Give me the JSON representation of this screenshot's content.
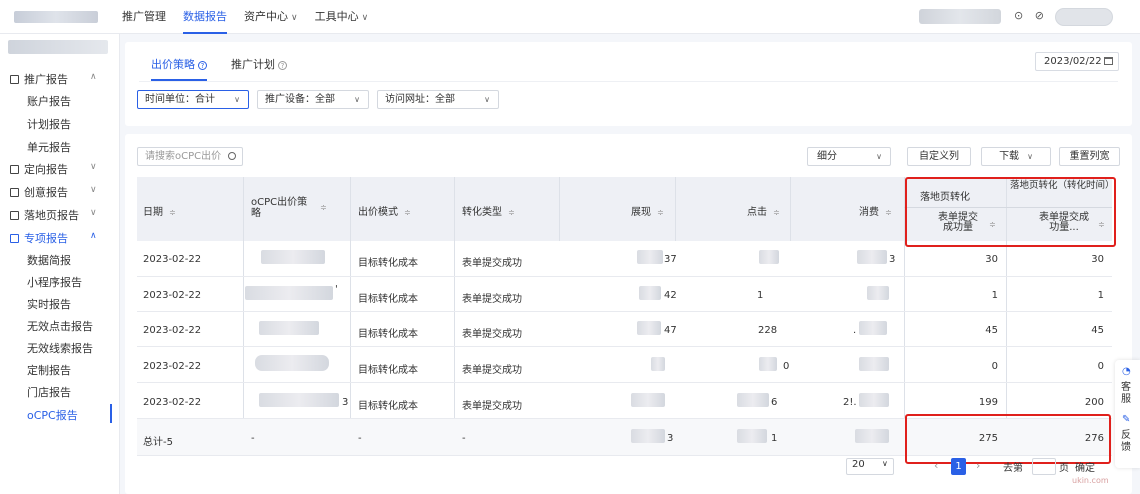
{
  "topbar": {
    "nav": [
      {
        "label": "推广管理",
        "active": false,
        "dropdown": false
      },
      {
        "label": "数据报告",
        "active": true,
        "dropdown": false
      },
      {
        "label": "资产中心",
        "active": false,
        "dropdown": true
      },
      {
        "label": "工具中心",
        "active": false,
        "dropdown": true
      }
    ],
    "caret": "∨",
    "icons": [
      "settings-icon",
      "link-icon"
    ],
    "icon_glyphs": "⊙ ⊘"
  },
  "sidebar": {
    "groups": [
      {
        "label": "推广报告",
        "open": true,
        "arrow": "∧",
        "items": [
          "账户报告",
          "计划报告",
          "单元报告"
        ]
      },
      {
        "label": "定向报告",
        "open": false,
        "arrow": "∨",
        "items": []
      },
      {
        "label": "创意报告",
        "open": false,
        "arrow": "∨",
        "items": []
      },
      {
        "label": "落地页报告",
        "open": false,
        "arrow": "∨",
        "items": []
      },
      {
        "label": "专项报告",
        "open": true,
        "arrow": "∧",
        "items": [
          "数据简报",
          "小程序报告",
          "实时报告",
          "无效点击报告",
          "无效线索报告",
          "定制报告",
          "门店报告",
          "oCPC报告"
        ]
      }
    ],
    "active_item": "oCPC报告"
  },
  "tabs": [
    {
      "label": "出价策略",
      "active": true
    },
    {
      "label": "推广计划",
      "active": false
    }
  ],
  "date": "2023/02/22",
  "filters": [
    {
      "label": "时间单位：合计",
      "focus": true
    },
    {
      "label": "推广设备：全部",
      "focus": false
    },
    {
      "label": "访问网址：全部",
      "focus": false
    }
  ],
  "toolbar": {
    "search_placeholder": "请搜索oCPC出价",
    "segment": "细分",
    "custom_columns": "自定义列",
    "download": "下载",
    "reset_width": "重置列宽"
  },
  "table": {
    "columns": [
      "日期",
      "oCPC出价策略",
      "出价模式",
      "转化类型",
      "展现",
      "点击",
      "消费"
    ],
    "group_headers": [
      "落地页转化",
      "落地页转化（转化时间）"
    ],
    "sub_headers": [
      "表单提交成功量",
      "表单提交成功量..."
    ],
    "sort_glyph": "≑",
    "rows": [
      {
        "date": "2023-02-22",
        "strategy": "",
        "mode": "目标转化成本",
        "conv_type": "表单提交成功",
        "impressions": "37",
        "clicks": "",
        "cost": "3",
        "conv": "30",
        "conv_time": "30"
      },
      {
        "date": "2023-02-22",
        "strategy": "'",
        "mode": "目标转化成本",
        "conv_type": "表单提交成功",
        "impressions": "42",
        "clicks": "1",
        "cost": "",
        "conv": "1",
        "conv_time": "1"
      },
      {
        "date": "2023-02-22",
        "strategy": "",
        "mode": "目标转化成本",
        "conv_type": "表单提交成功",
        "impressions": "47",
        "clicks": "228",
        "cost": ".",
        "conv": "45",
        "conv_time": "45"
      },
      {
        "date": "2023-02-22",
        "strategy": "",
        "mode": "目标转化成本",
        "conv_type": "表单提交成功",
        "impressions": "",
        "clicks": "0",
        "cost": "",
        "conv": "0",
        "conv_time": "0"
      },
      {
        "date": "2023-02-22",
        "strategy": "3",
        "mode": "目标转化成本",
        "conv_type": "表单提交成功",
        "impressions": "",
        "clicks": "6",
        "cost": "2!.",
        "conv": "199",
        "conv_time": "200"
      }
    ],
    "total": {
      "date": "总计-5",
      "strategy": "-",
      "mode": "-",
      "conv_type": "-",
      "impressions": "3",
      "clicks": "1",
      "cost": "",
      "conv": "275",
      "conv_time": "276"
    }
  },
  "pagination": {
    "page_size": "20",
    "current_page": "1",
    "goto_label": "去第",
    "page_unit": "页",
    "confirm": "确定",
    "prev": "‹",
    "next": "›"
  },
  "float_helper": {
    "service": "客服",
    "feedback": "反馈"
  },
  "watermark": "ukin.com",
  "colors": {
    "accent": "#2a60e6",
    "annotation": "#e0201c",
    "header_bg": "#eef0f5"
  }
}
